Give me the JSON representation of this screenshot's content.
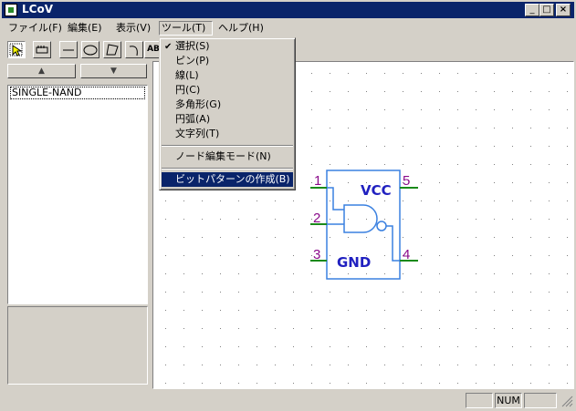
{
  "window": {
    "title": "LCoV",
    "minimize": "_",
    "maximize": "□",
    "close": "×"
  },
  "menubar": {
    "items": [
      {
        "label": "ファイル(F)",
        "accel": "F"
      },
      {
        "label": "編集(E)",
        "accel": "E"
      },
      {
        "label": "表示(V)",
        "accel": "V"
      },
      {
        "label": "ツール(T)",
        "accel": "T"
      },
      {
        "label": "ヘルプ(H)",
        "accel": "H"
      }
    ]
  },
  "toolbar": {
    "text_tool_label": "AB",
    "icons": [
      "select-arrow-icon",
      "pin-icon",
      "line-icon",
      "ellipse-icon",
      "polygon-icon",
      "arc-icon",
      "text-icon"
    ]
  },
  "left_panel": {
    "up_arrow": "▲",
    "down_arrow": "▼",
    "list": [
      "SINGLE-NAND"
    ]
  },
  "tools_menu": {
    "check_mark": "✔",
    "items": [
      {
        "label": "選択(S)",
        "checked": true
      },
      {
        "label": "ピン(P)"
      },
      {
        "label": "線(L)"
      },
      {
        "label": "円(C)"
      },
      {
        "label": "多角形(G)"
      },
      {
        "label": "円弧(A)"
      },
      {
        "label": "文字列(T)"
      }
    ],
    "node_edit": "ノード編集モード(N)",
    "bitpattern": "ビットパターンの作成(B)"
  },
  "schematic": {
    "pins": [
      {
        "num": "1",
        "side": "left"
      },
      {
        "num": "2",
        "side": "left"
      },
      {
        "num": "3",
        "side": "left"
      },
      {
        "num": "5",
        "side": "right"
      },
      {
        "num": "4",
        "side": "right"
      }
    ],
    "vcc_label": "VCC",
    "gnd_label": "GND",
    "colors": {
      "body": "#3a80e0",
      "pin_line": "#1a8a1a",
      "pin_number": "#8a0a8a",
      "label": "#2020c0"
    }
  },
  "statusbar": {
    "num": "NUM"
  }
}
